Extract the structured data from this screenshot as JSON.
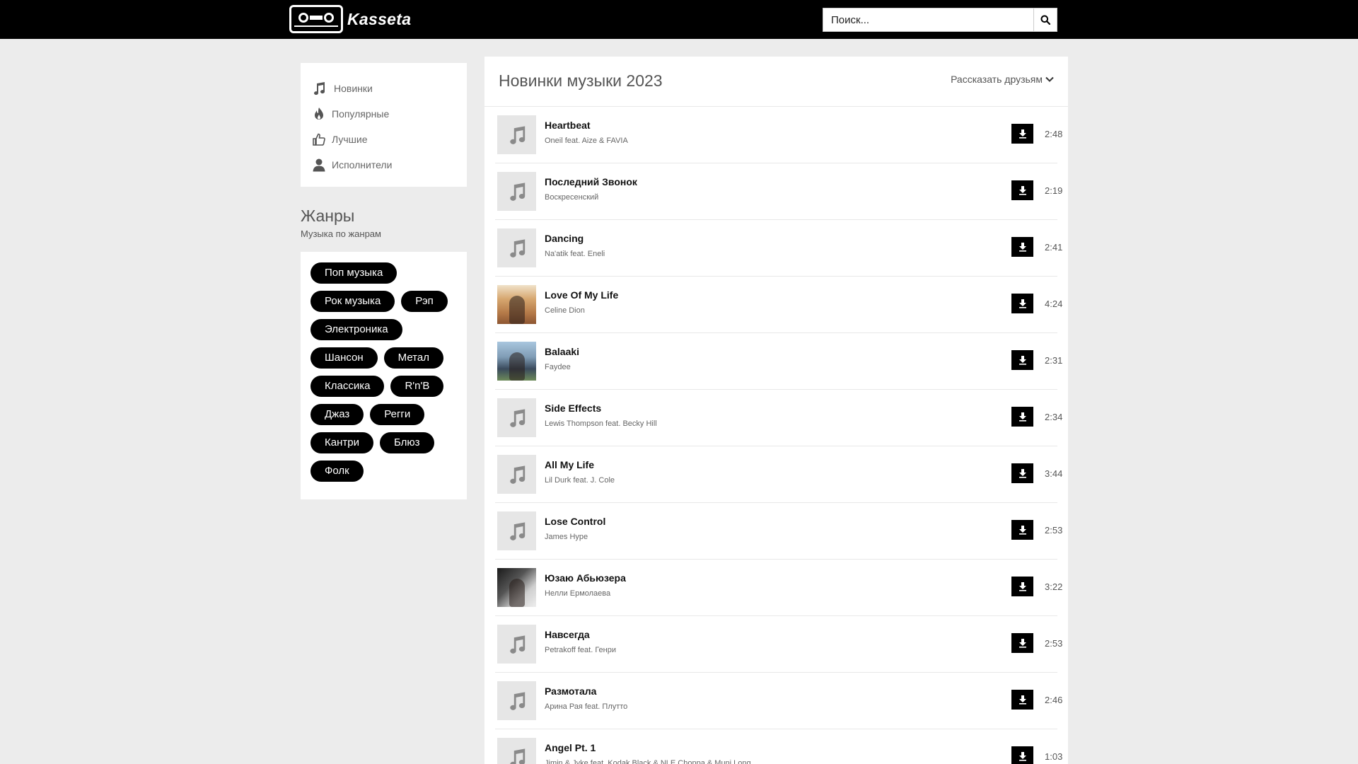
{
  "header": {
    "logo_text": "Kasseta",
    "search_placeholder": "Поиск...",
    "search_value": ""
  },
  "sidebar": {
    "nav": [
      {
        "label": "Новинки",
        "icon": "music-note-icon"
      },
      {
        "label": "Популярные",
        "icon": "fire-icon"
      },
      {
        "label": "Лучшие",
        "icon": "thumbs-up-icon"
      },
      {
        "label": "Исполнители",
        "icon": "user-icon"
      }
    ],
    "genres_title": "Жанры",
    "genres_subtitle": "Музыка по жанрам",
    "genres": [
      "Поп музыка",
      "Рок музыка",
      "Рэп",
      "Электроника",
      "Шансон",
      "Метал",
      "Классика",
      "R'n'B",
      "Джаз",
      "Регги",
      "Кантри",
      "Блюз",
      "Фолк"
    ]
  },
  "main": {
    "title": "Новинки музыки 2023",
    "share_label": "Рассказать друзьям",
    "tracks": [
      {
        "title": "Heartbeat",
        "artist": "Oneil feat. Aize & FAVIA",
        "duration": "2:48",
        "cover": "placeholder"
      },
      {
        "title": "Последний Звонок",
        "artist": "Воскресенский",
        "duration": "2:19",
        "cover": "placeholder"
      },
      {
        "title": "Dancing",
        "artist": "Na'atik feat. Eneli",
        "duration": "2:41",
        "cover": "placeholder"
      },
      {
        "title": "Love Of My Life",
        "artist": "Celine Dion",
        "duration": "4:24",
        "cover": "photo"
      },
      {
        "title": "Balaaki",
        "artist": "Faydee",
        "duration": "2:31",
        "cover": "photo"
      },
      {
        "title": "Side Effects",
        "artist": "Lewis Thompson feat. Becky Hill",
        "duration": "2:34",
        "cover": "placeholder"
      },
      {
        "title": "All My Life",
        "artist": "Lil Durk feat. J. Cole",
        "duration": "3:44",
        "cover": "placeholder"
      },
      {
        "title": "Lose Control",
        "artist": "James Hype",
        "duration": "2:53",
        "cover": "placeholder"
      },
      {
        "title": "Юзаю Абьюзера",
        "artist": "Нелли Ермолаева",
        "duration": "3:22",
        "cover": "photo"
      },
      {
        "title": "Навсегда",
        "artist": "Petrakoff feat. Генри",
        "duration": "2:53",
        "cover": "placeholder"
      },
      {
        "title": "Размотала",
        "artist": "Арина Рая feat. Плутто",
        "duration": "2:46",
        "cover": "placeholder"
      },
      {
        "title": "Angel Pt. 1",
        "artist": "Jimin & Jvke feat. Kodak Black & NLE Choppa & Muni Long",
        "duration": "1:03",
        "cover": "placeholder"
      }
    ]
  }
}
